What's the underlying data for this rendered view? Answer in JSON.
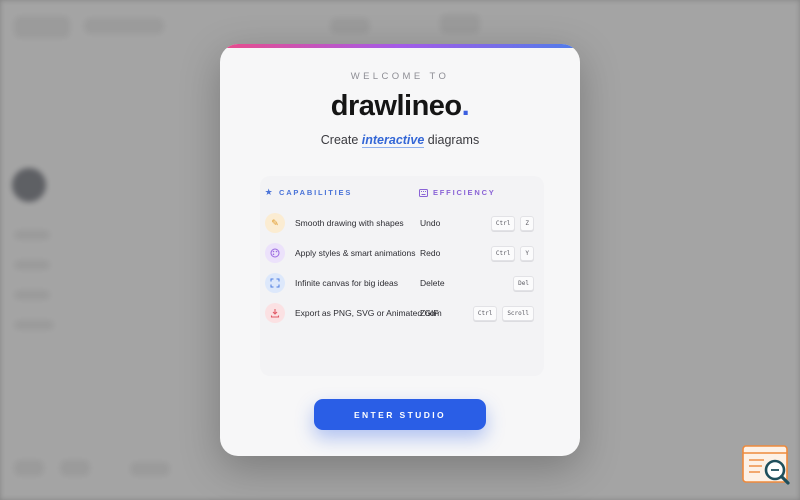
{
  "modal": {
    "welcome": "WELCOME TO",
    "brand": "drawlineo",
    "brand_dot": ".",
    "tagline_prefix": "Create",
    "tagline_highlight": "interactive",
    "tagline_suffix": "diagrams",
    "capabilities_heading": "CAPABILITIES",
    "efficiency_heading": "EFFICIENCY",
    "features": [
      {
        "label": "Smooth drawing with shapes",
        "icon": "pencil-icon"
      },
      {
        "label": "Apply styles & smart animations",
        "icon": "palette-icon"
      },
      {
        "label": "Infinite canvas for big ideas",
        "icon": "expand-icon"
      },
      {
        "label": "Export as PNG, SVG or Animated GIF",
        "icon": "download-icon"
      }
    ],
    "shortcuts": [
      {
        "name": "Undo",
        "keys": [
          "Ctrl",
          "Z"
        ]
      },
      {
        "name": "Redo",
        "keys": [
          "Ctrl",
          "Y"
        ]
      },
      {
        "name": "Delete",
        "keys": [
          "Del"
        ]
      },
      {
        "name": "Zoom",
        "keys": [
          "Ctrl",
          "Scroll"
        ]
      }
    ],
    "enter_label": "ENTER STUDIO"
  },
  "colors": {
    "accent": "#2a5ee6",
    "brand_dot": "#3b5fe0",
    "capabilities": "#4a73d8",
    "efficiency": "#8a63d6"
  }
}
